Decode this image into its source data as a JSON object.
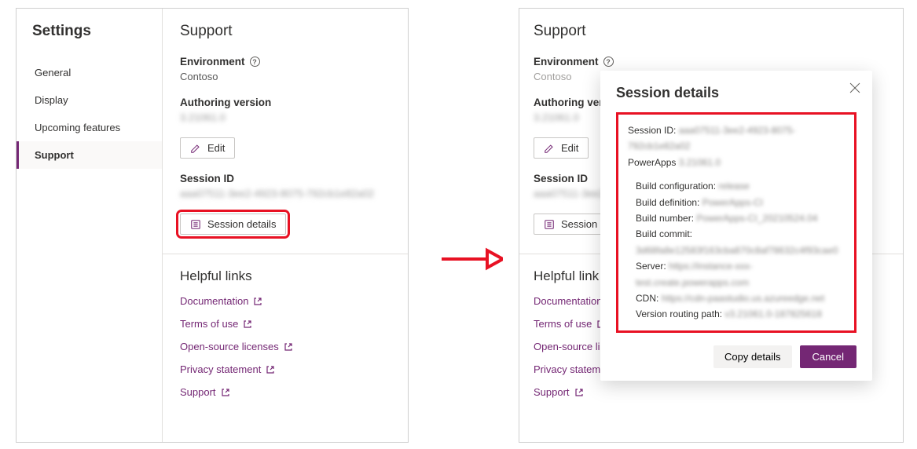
{
  "left": {
    "settings_title": "Settings",
    "nav": [
      "General",
      "Display",
      "Upcoming features",
      "Support"
    ],
    "nav_active_index": 3,
    "page_title": "Support",
    "env_label": "Environment",
    "env_value": "Contoso",
    "authver_label": "Authoring version",
    "authver_value": "3.21061.0",
    "edit_label": "Edit",
    "session_id_label": "Session ID",
    "session_id_value": "aaa07511-3ee2-4923-8075-792cb1e82a02",
    "session_details_label": "Session details",
    "helpful_title": "Helpful links",
    "links": [
      "Documentation",
      "Terms of use",
      "Open-source licenses",
      "Privacy statement",
      "Support"
    ]
  },
  "right": {
    "page_title": "Support",
    "env_label": "Environment",
    "env_value": "Contoso",
    "authver_label": "Authoring vers",
    "authver_value": "3.21061.0",
    "edit_label": "Edit",
    "session_id_label": "Session ID",
    "session_id_value": "aaa07511-3ee2-",
    "session_details_label": "Session de",
    "helpful_title": "Helpful link",
    "links": [
      "Documentation",
      "Terms of use",
      "Open-source lic",
      "Privacy statement",
      "Support"
    ]
  },
  "dialog": {
    "title": "Session details",
    "session_id_k": "Session ID:",
    "session_id_v": "aaa07511-3ee2-4923-8075-792cb1e82a02",
    "powerapps_k": "PowerApps",
    "powerapps_v": "3.21061.0",
    "build_config_k": "Build configuration:",
    "build_config_v": "release",
    "build_def_k": "Build definition:",
    "build_def_v": "PowerApps-CI",
    "build_num_k": "Build number:",
    "build_num_v": "PowerApps-CI_20210524.04",
    "build_commit_k": "Build commit:",
    "build_commit_v": "3d68fa8e12583f163cba870c8af78632c4f93cae0",
    "server_k": "Server:",
    "server_v": "https://instance-xxx-test.create.powerapps.com",
    "cdn_k": "CDN:",
    "cdn_v": "https://cdn-paastudio.us.azureedge.net",
    "vrp_k": "Version routing path:",
    "vrp_v": "v3.21061.0-187825618",
    "copy_label": "Copy details",
    "cancel_label": "Cancel"
  }
}
